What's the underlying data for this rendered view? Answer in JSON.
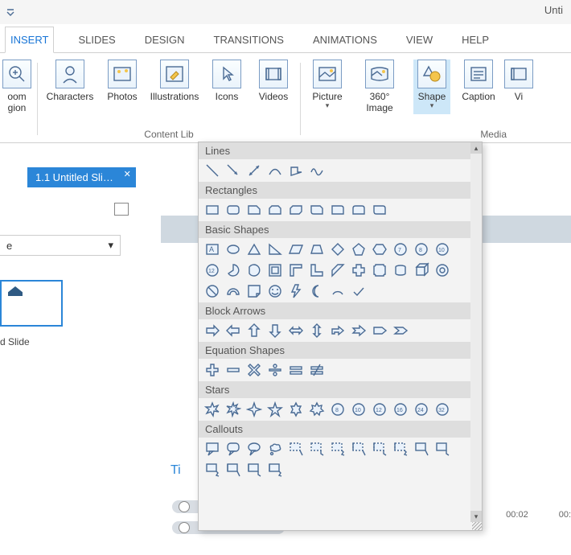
{
  "app": {
    "title_partial": "Unti"
  },
  "tabs": {
    "active": "INSERT",
    "items": [
      "INSERT",
      "SLIDES",
      "DESIGN",
      "TRANSITIONS",
      "ANIMATIONS",
      "VIEW",
      "HELP"
    ]
  },
  "ribbon": {
    "left_cut": {
      "label_line1": "oom",
      "label_line2": "gion"
    },
    "content_library": {
      "group_label": "Content Lib",
      "buttons": [
        {
          "name": "characters",
          "label": "Characters"
        },
        {
          "name": "photos",
          "label": "Photos"
        },
        {
          "name": "illustrations",
          "label": "Illustrations"
        },
        {
          "name": "icons",
          "label": "Icons"
        },
        {
          "name": "videos",
          "label": "Videos"
        }
      ]
    },
    "media": {
      "group_label_partial": "Media",
      "buttons": [
        {
          "name": "picture",
          "label": "Picture",
          "dropdown": true
        },
        {
          "name": "360image",
          "label": "360° Image"
        },
        {
          "name": "shape",
          "label": "Shape",
          "dropdown": true,
          "selected": true
        },
        {
          "name": "caption",
          "label": "Caption"
        },
        {
          "name": "video_cut",
          "label": "Vi"
        }
      ]
    }
  },
  "slide_tab": {
    "label": "1.1 Untitled Sli…"
  },
  "left_panel": {
    "scene_dropdown_value": "e",
    "slide_caption": "d Slide"
  },
  "canvas": {
    "title_partial": "Ti"
  },
  "timeline": {
    "ticks": [
      "00:02",
      "00:"
    ]
  },
  "shape_menu": {
    "categories": [
      {
        "name": "Lines",
        "count": 6
      },
      {
        "name": "Rectangles",
        "count": 9
      },
      {
        "name": "Basic Shapes",
        "count": 33
      },
      {
        "name": "Block Arrows",
        "count": 10
      },
      {
        "name": "Equation Shapes",
        "count": 6
      },
      {
        "name": "Stars",
        "count": 11
      },
      {
        "name": "Callouts",
        "count": 16
      }
    ]
  }
}
